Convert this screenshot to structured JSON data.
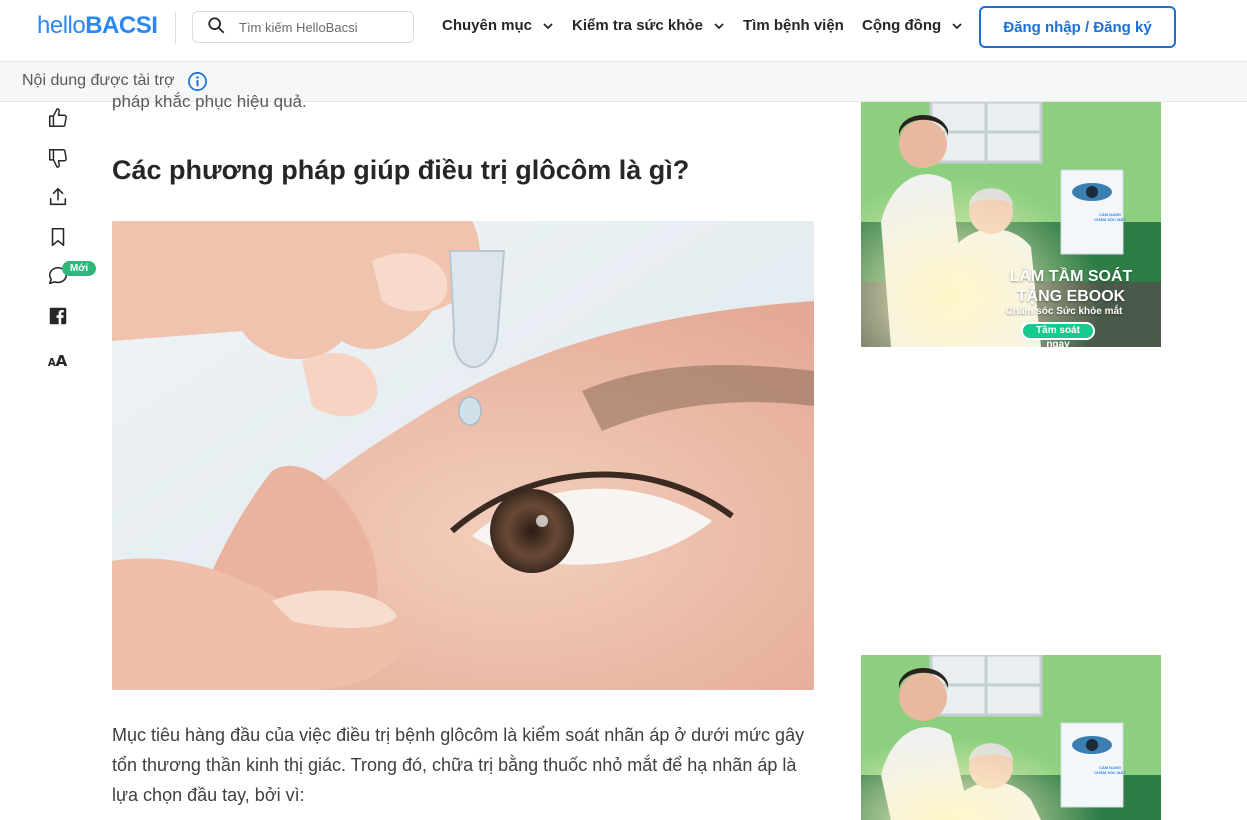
{
  "header": {
    "logo_hello": "hello",
    "logo_bacsi": "BACSI",
    "search_placeholder": "Tìm kiếm HelloBacsi",
    "nav": [
      {
        "label": "Chuyên mục",
        "has_chevron": true
      },
      {
        "label": "Kiểm tra sức khỏe",
        "has_chevron": true
      },
      {
        "label": "Tìm bệnh viện",
        "has_chevron": false
      },
      {
        "label": "Cộng đồng",
        "has_chevron": true
      }
    ],
    "login_label": "Đăng nhập / Đăng ký"
  },
  "sponsor": {
    "label": "Nội dung được tài trợ",
    "icon": "info-icon"
  },
  "toolbar": {
    "icons": [
      "thumbs-up-icon",
      "thumbs-down-icon",
      "share-icon",
      "bookmark-icon",
      "comment-icon",
      "facebook-icon",
      "font-size-icon"
    ],
    "comment_badge": "Mới"
  },
  "article": {
    "cut_text": "pháp khắc phục hiệu quả.",
    "heading": "Các phương pháp giúp điều trị glôcôm là gì?",
    "paragraph": "Mục tiêu hàng đầu của việc điều trị bệnh glôcôm là kiểm soát nhãn áp ở dưới mức gây tổn thương thần kinh thị giác. Trong đó, chữa trị bằng thuốc nhỏ mắt để hạ nhãn áp là lựa chọn đầu tay, bởi vì:"
  },
  "ads": [
    {
      "headline_1": "LÀM TẦM SOÁT",
      "headline_2": "TẶNG EBOOK",
      "subline": "Chăm sóc Sức khỏe mắt",
      "button": "Tầm soát ngay",
      "book_title": "CẨM NANG CHĂM SÓC MẮT"
    },
    {
      "book_title": "CẨM NANG CHĂM SÓC MẮT"
    }
  ],
  "colors": {
    "brand": "#2d87f3",
    "login_border": "#1b6fd6",
    "badge": "#2fb67a",
    "ad_bg": "#2e7d46",
    "ad_button": "#16c98d"
  }
}
